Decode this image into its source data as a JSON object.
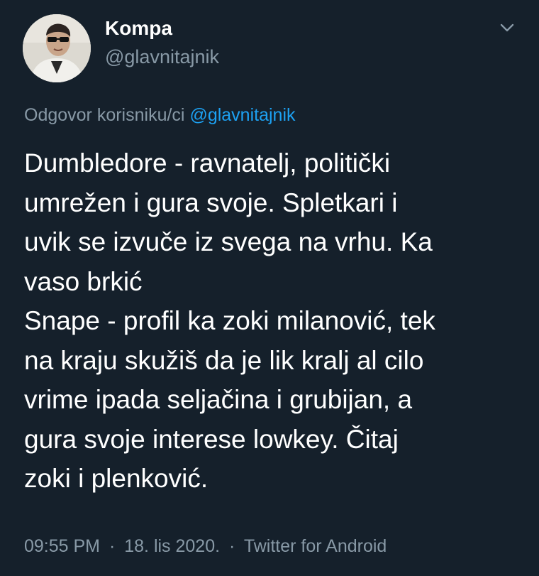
{
  "author": {
    "display_name": "Kompa",
    "handle": "@glavnitajnik"
  },
  "reply": {
    "prefix": "Odgovor korisniku/ci",
    "mention": "@glavnitajnik"
  },
  "tweet": {
    "lines": [
      "Dumbledore - ravnatelj, politički",
      "umrežen i gura svoje. Spletkari i",
      "uvik se izvuče iz svega na vrhu. Ka",
      "vaso brkić",
      "Snape - profil ka zoki milanović, tek",
      "na kraju skužiš da je lik kralj al cilo",
      "vrime ipada seljačina i grubijan, a",
      "gura svoje interese lowkey. Čitaj",
      "zoki i plenković."
    ]
  },
  "meta": {
    "time": "09:55 PM",
    "separator": "·",
    "date": "18. lis 2020.",
    "source": "Twitter for Android"
  },
  "icons": {
    "caret": "chevron-down-icon",
    "avatar": "profile-photo"
  },
  "colors": {
    "background": "#15202b",
    "primary_text": "#ffffff",
    "secondary_text": "#8899a6",
    "link": "#1da1f2"
  }
}
